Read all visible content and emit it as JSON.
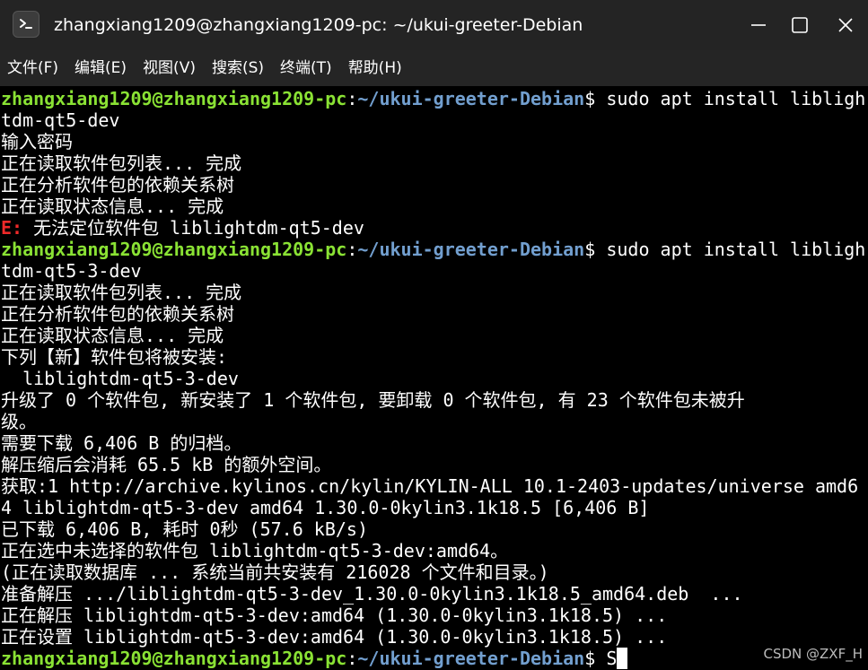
{
  "window": {
    "title": "zhangxiang1209@zhangxiang1209-pc: ~/ukui-greeter-Debian",
    "app_icon": "terminal-icon",
    "controls": [
      "minimize-icon",
      "maximize-icon",
      "close-icon"
    ]
  },
  "menu": [
    {
      "label": "文件(F)"
    },
    {
      "label": "编辑(E)"
    },
    {
      "label": "视图(V)"
    },
    {
      "label": "搜索(S)"
    },
    {
      "label": "终端(T)"
    },
    {
      "label": "帮助(H)"
    }
  ],
  "prompt": {
    "user_host": "zhangxiang1209@zhangxiang1209-pc",
    "colon": ":",
    "path": "~/ukui-greeter-Debian",
    "dollar": "$ "
  },
  "lines": [
    {
      "type": "prompt",
      "cmd": "sudo apt install libligh"
    },
    {
      "type": "text",
      "text": "tdm-qt5-dev"
    },
    {
      "type": "text",
      "text": "输入密码"
    },
    {
      "type": "text",
      "text": "正在读取软件包列表... 完成"
    },
    {
      "type": "text",
      "text": "正在分析软件包的依赖关系树"
    },
    {
      "type": "text",
      "text": "正在读取状态信息... 完成"
    },
    {
      "type": "error",
      "prefix": "E:",
      "text": " 无法定位软件包 liblightdm-qt5-dev"
    },
    {
      "type": "prompt",
      "cmd": "sudo apt install libligh"
    },
    {
      "type": "text",
      "text": "tdm-qt5-3-dev"
    },
    {
      "type": "text",
      "text": "正在读取软件包列表... 完成"
    },
    {
      "type": "text",
      "text": "正在分析软件包的依赖关系树"
    },
    {
      "type": "text",
      "text": "正在读取状态信息... 完成"
    },
    {
      "type": "text",
      "text": "下列【新】软件包将被安装:"
    },
    {
      "type": "text",
      "text": "  liblightdm-qt5-3-dev"
    },
    {
      "type": "text",
      "text": "升级了 0 个软件包, 新安装了 1 个软件包, 要卸载 0 个软件包, 有 23 个软件包未被升"
    },
    {
      "type": "text",
      "text": "级。"
    },
    {
      "type": "text",
      "text": "需要下载 6,406 B 的归档。"
    },
    {
      "type": "text",
      "text": "解压缩后会消耗 65.5 kB 的额外空间。"
    },
    {
      "type": "text",
      "text": "获取:1 http://archive.kylinos.cn/kylin/KYLIN-ALL 10.1-2403-updates/universe amd6"
    },
    {
      "type": "text",
      "text": "4 liblightdm-qt5-3-dev amd64 1.30.0-0kylin3.1k18.5 [6,406 B]"
    },
    {
      "type": "text",
      "text": "已下载 6,406 B, 耗时 0秒 (57.6 kB/s)"
    },
    {
      "type": "text",
      "text": "正在选中未选择的软件包 liblightdm-qt5-3-dev:amd64。"
    },
    {
      "type": "text",
      "text": "(正在读取数据库 ... 系统当前共安装有 216028 个文件和目录。)"
    },
    {
      "type": "text",
      "text": "准备解压 .../liblightdm-qt5-3-dev_1.30.0-0kylin3.1k18.5_amd64.deb  ..."
    },
    {
      "type": "text",
      "text": "正在解压 liblightdm-qt5-3-dev:amd64 (1.30.0-0kylin3.1k18.5) ..."
    },
    {
      "type": "text",
      "text": "正在设置 liblightdm-qt5-3-dev:amd64 (1.30.0-0kylin3.1k18.5) ..."
    },
    {
      "type": "prompt",
      "cmd": "S",
      "cursor": true
    }
  ],
  "watermark": "CSDN @ZXF_H",
  "colors": {
    "user": "#8ae234",
    "path": "#729fcf",
    "error": "#ef2929",
    "text": "#ffffff",
    "background": "#000000",
    "titlebar": "#242424"
  }
}
